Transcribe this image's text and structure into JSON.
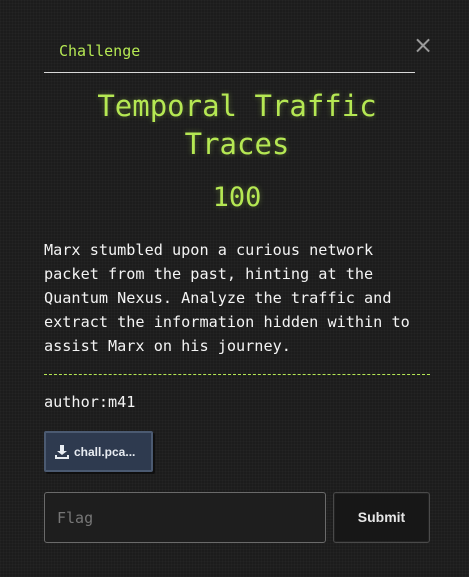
{
  "header": {
    "tab_label": "Challenge",
    "close_glyph": "×"
  },
  "challenge": {
    "title_line1": "Temporal Traffic",
    "title_line2": "Traces",
    "points": "100",
    "description_lines": [
      "Marx stumbled upon a curious network",
      "packet from the past, hinting at the",
      "Quantum Nexus. Analyze the traffic and",
      "extract the information hidden within to",
      "assist Marx on his journey."
    ],
    "author": "author:m41"
  },
  "files": [
    {
      "label": "chall.pca...",
      "icon": "download-icon"
    }
  ],
  "form": {
    "flag_placeholder": "Flag",
    "flag_value": "",
    "submit_label": "Submit"
  },
  "colors": {
    "accent": "#b5e853",
    "background": "#1c1c1c",
    "file_button": "#2e3a4f",
    "text": "#f4f4f4"
  }
}
